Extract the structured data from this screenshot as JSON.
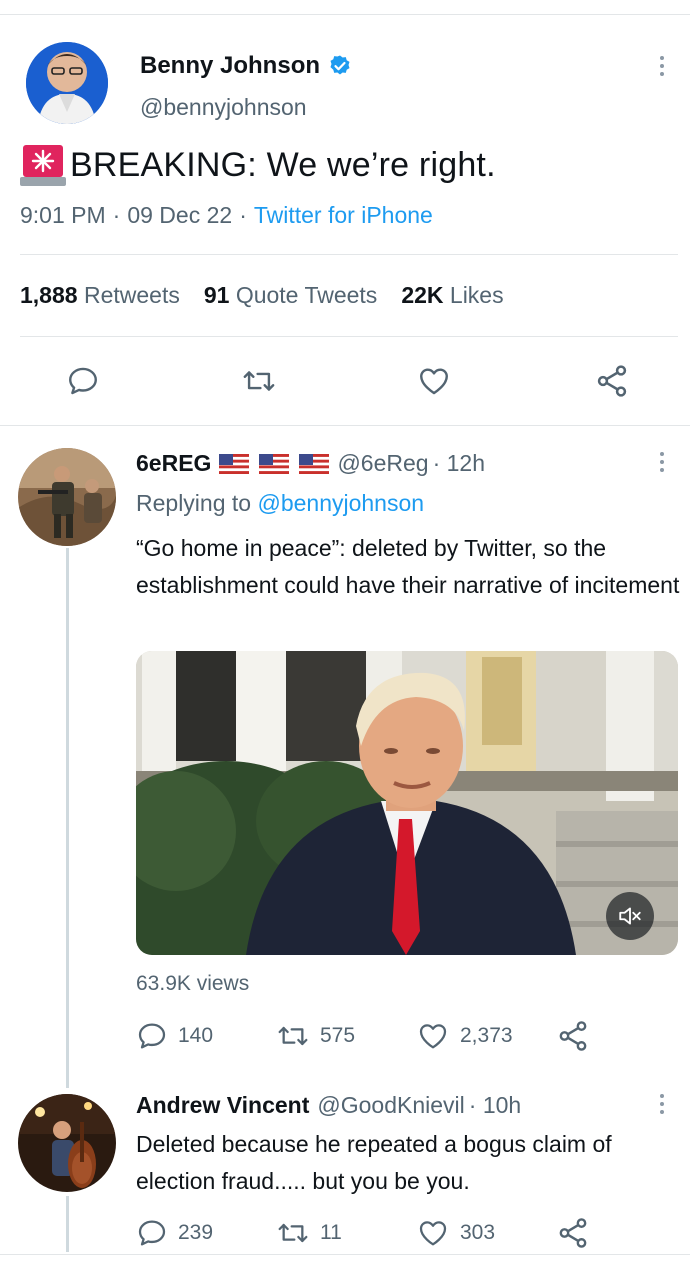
{
  "main_tweet": {
    "author_name": "Benny Johnson",
    "handle": "@bennyjohnson",
    "text": "BREAKING: We we’re right.",
    "time": "9:01 PM",
    "date": "09 Dec 22",
    "client": "Twitter for iPhone",
    "sep": "·",
    "stats": {
      "retweets_count": "1,888",
      "retweets_label": "Retweets",
      "quotes_count": "91",
      "quotes_label": "Quote Tweets",
      "likes_count": "22K",
      "likes_label": "Likes"
    }
  },
  "replies": [
    {
      "author_name": "6eREG",
      "flags": "🇺🇸 🇺🇸 🇺🇸",
      "handle": "@6eReg",
      "time": "· 12h",
      "replying_prefix": "Replying to",
      "replying_to": "@bennyjohnson",
      "text": "“Go home in peace”: deleted by Twitter, so the establishment could have their narrative of incitement",
      "views": "63.9K views",
      "reply_count": "140",
      "retweet_count": "575",
      "like_count": "2,373"
    },
    {
      "author_name": "Andrew Vincent",
      "handle": "@GoodKnievil",
      "time": "· 10h",
      "text": "Deleted because he repeated a bogus claim of election fraud..... but you be you.",
      "reply_count": "239",
      "retweet_count": "11",
      "like_count": "303"
    }
  ],
  "colors": {
    "accent": "#1d9bf0",
    "text": "#0f1419",
    "muted": "#536471",
    "divider": "#e3e6e8",
    "alert": "#e0245e"
  },
  "icons": {
    "verified": "verified-badge-icon",
    "reply": "reply-icon",
    "retweet": "retweet-icon",
    "like": "heart-icon",
    "share": "share-icon",
    "mute": "mute-icon",
    "siren": "siren-emoji-icon"
  }
}
